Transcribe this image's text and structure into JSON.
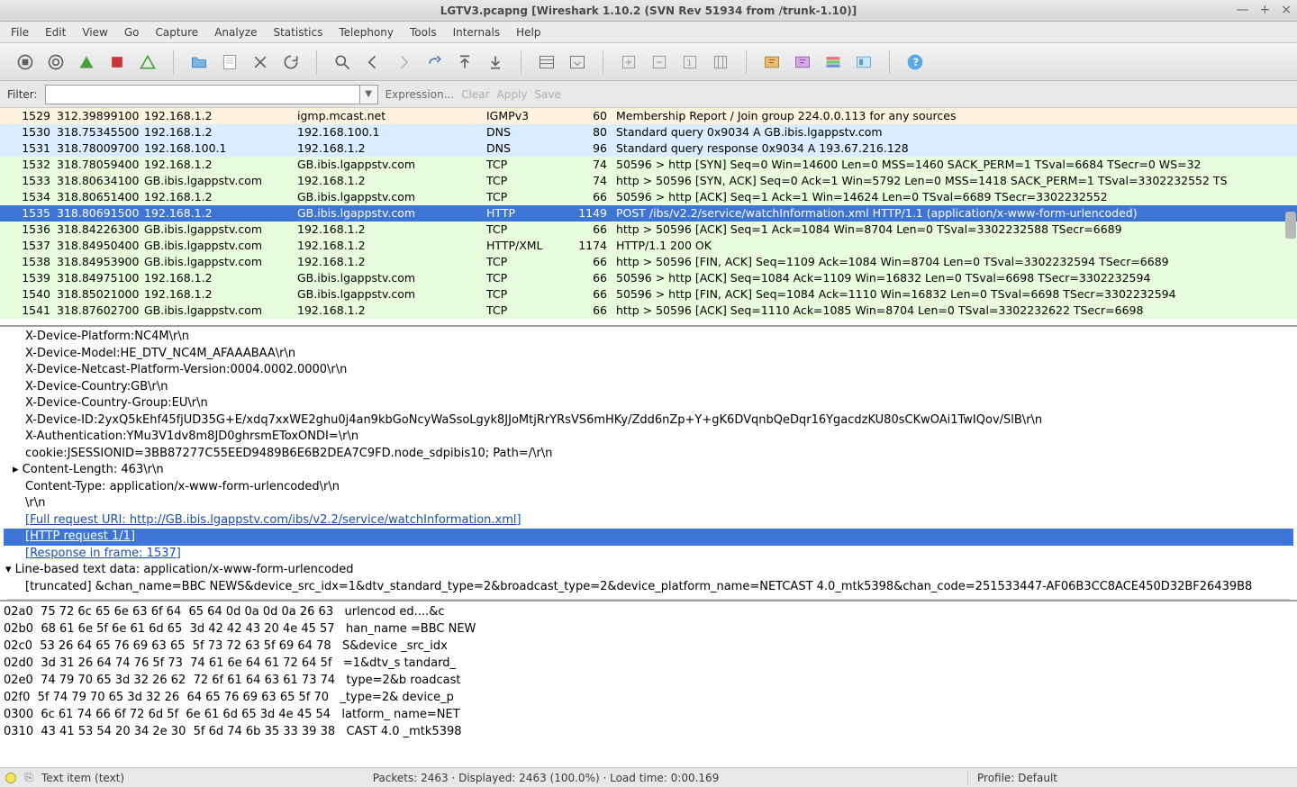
{
  "window": {
    "title": "LGTV3.pcapng   [Wireshark 1.10.2  (SVN Rev 51934 from /trunk-1.10)]",
    "minimize": "—",
    "maximize": "+",
    "close": "×"
  },
  "menu": [
    "File",
    "Edit",
    "View",
    "Go",
    "Capture",
    "Analyze",
    "Statistics",
    "Telephony",
    "Tools",
    "Internals",
    "Help"
  ],
  "filter": {
    "label": "Filter:",
    "value": "",
    "expression": "Expression...",
    "clear": "Clear",
    "apply": "Apply",
    "save": "Save"
  },
  "packets": [
    {
      "cls": "row-igmp",
      "no": "1529",
      "time": "312.39899100",
      "src": "192.168.1.2",
      "dst": "igmp.mcast.net",
      "proto": "IGMPv3",
      "len": "60",
      "info": "Membership Report / Join group 224.0.0.113 for any sources"
    },
    {
      "cls": "row-dns",
      "no": "1530",
      "time": "318.75345500",
      "src": "192.168.1.2",
      "dst": "192.168.100.1",
      "proto": "DNS",
      "len": "80",
      "info": "Standard query 0x9034  A GB.ibis.lgappstv.com"
    },
    {
      "cls": "row-dns",
      "no": "1531",
      "time": "318.78009700",
      "src": "192.168.100.1",
      "dst": "192.168.1.2",
      "proto": "DNS",
      "len": "96",
      "info": "Standard query response 0x9034  A 193.67.216.128"
    },
    {
      "cls": "row-tcp",
      "no": "1532",
      "time": "318.78059400",
      "src": "192.168.1.2",
      "dst": "GB.ibis.lgappstv.com",
      "proto": "TCP",
      "len": "74",
      "info": "50596 > http [SYN] Seq=0 Win=14600 Len=0 MSS=1460 SACK_PERM=1 TSval=6684 TSecr=0 WS=32"
    },
    {
      "cls": "row-tcp",
      "no": "1533",
      "time": "318.80634100",
      "src": "GB.ibis.lgappstv.com",
      "dst": "192.168.1.2",
      "proto": "TCP",
      "len": "74",
      "info": "http > 50596 [SYN, ACK] Seq=0 Ack=1 Win=5792 Len=0 MSS=1418 SACK_PERM=1 TSval=3302232552 TS"
    },
    {
      "cls": "row-tcp",
      "no": "1534",
      "time": "318.80651400",
      "src": "192.168.1.2",
      "dst": "GB.ibis.lgappstv.com",
      "proto": "TCP",
      "len": "66",
      "info": "50596 > http [ACK] Seq=1 Ack=1 Win=14624 Len=0 TSval=6689 TSecr=3302232552"
    },
    {
      "cls": "row-selected",
      "no": "1535",
      "time": "318.80691500",
      "src": "192.168.1.2",
      "dst": "GB.ibis.lgappstv.com",
      "proto": "HTTP",
      "len": "1149",
      "info": "POST /ibs/v2.2/service/watchInformation.xml HTTP/1.1   (application/x-www-form-urlencoded)"
    },
    {
      "cls": "row-tcp",
      "no": "1536",
      "time": "318.84226300",
      "src": "GB.ibis.lgappstv.com",
      "dst": "192.168.1.2",
      "proto": "TCP",
      "len": "66",
      "info": "http > 50596 [ACK] Seq=1 Ack=1084 Win=8704 Len=0 TSval=3302232588 TSecr=6689"
    },
    {
      "cls": "row-http",
      "no": "1537",
      "time": "318.84950400",
      "src": "GB.ibis.lgappstv.com",
      "dst": "192.168.1.2",
      "proto": "HTTP/XML",
      "len": "1174",
      "info": "HTTP/1.1 200 OK"
    },
    {
      "cls": "row-tcp",
      "no": "1538",
      "time": "318.84953900",
      "src": "GB.ibis.lgappstv.com",
      "dst": "192.168.1.2",
      "proto": "TCP",
      "len": "66",
      "info": "http > 50596 [FIN, ACK] Seq=1109 Ack=1084 Win=8704 Len=0 TSval=3302232594 TSecr=6689"
    },
    {
      "cls": "row-tcp",
      "no": "1539",
      "time": "318.84975100",
      "src": "192.168.1.2",
      "dst": "GB.ibis.lgappstv.com",
      "proto": "TCP",
      "len": "66",
      "info": "50596 > http [ACK] Seq=1084 Ack=1109 Win=16832 Len=0 TSval=6698 TSecr=3302232594"
    },
    {
      "cls": "row-tcp",
      "no": "1540",
      "time": "318.85021000",
      "src": "192.168.1.2",
      "dst": "GB.ibis.lgappstv.com",
      "proto": "TCP",
      "len": "66",
      "info": "50596 > http [FIN, ACK] Seq=1084 Ack=1110 Win=16832 Len=0 TSval=6698 TSecr=3302232594"
    },
    {
      "cls": "row-tcp",
      "no": "1541",
      "time": "318.87602700",
      "src": "GB.ibis.lgappstv.com",
      "dst": "192.168.1.2",
      "proto": "TCP",
      "len": "66",
      "info": "http > 50596 [ACK] Seq=1110 Ack=1085 Win=8704 Len=0 TSval=3302232622 TSecr=6698"
    }
  ],
  "detail": [
    {
      "cls": "line",
      "text": "X-Device-Platform:NC4M\\r\\n"
    },
    {
      "cls": "line",
      "text": "X-Device-Model:HE_DTV_NC4M_AFAAABAA\\r\\n"
    },
    {
      "cls": "line",
      "text": "X-Device-Netcast-Platform-Version:0004.0002.0000\\r\\n"
    },
    {
      "cls": "line",
      "text": "X-Device-Country:GB\\r\\n"
    },
    {
      "cls": "line",
      "text": "X-Device-Country-Group:EU\\r\\n"
    },
    {
      "cls": "line",
      "text": "X-Device-ID:2yxQ5kEhf45fjUD35G+E/xdq7xxWE2ghu0j4an9kbGoNcyWaSsoLgyk8JJoMtjRrYRsVS6mHKy/Zdd6nZp+Y+gK6DVqnbQeDqr16YgacdzKU80sCKwOAi1TwIQov/SlB\\r\\n"
    },
    {
      "cls": "line",
      "text": "X-Authentication:YMu3V1dv8m8JD0ghrsmEToxONDI=\\r\\n"
    },
    {
      "cls": "line",
      "text": "cookie:JSESSIONID=3BB87277C55EED9489B6E6B2DEA7C9FD.node_sdpibis10; Path=/\\r\\n"
    },
    {
      "cls": "line tri",
      "text": "▸ Content-Length: 463\\r\\n"
    },
    {
      "cls": "line",
      "text": "Content-Type: application/x-www-form-urlencoded\\r\\n"
    },
    {
      "cls": "line",
      "text": "\\r\\n"
    },
    {
      "cls": "line link",
      "text": "[Full request URI: http://GB.ibis.lgappstv.com/ibs/v2.2/service/watchInformation.xml]"
    },
    {
      "cls": "line link sel",
      "text": "[HTTP request 1/1]"
    },
    {
      "cls": "line link",
      "text": "[Response in frame: 1537]"
    },
    {
      "cls": "line sect",
      "text": "▾ Line-based text data: application/x-www-form-urlencoded"
    },
    {
      "cls": "line",
      "text": "[truncated] &chan_name=BBC NEWS&device_src_idx=1&dtv_standard_type=2&broadcast_type=2&device_platform_name=NETCAST 4.0_mtk5398&chan_code=251533447-AF06B3CC8ACE450D32BF26439B8"
    }
  ],
  "hex": [
    "02a0  75 72 6c 65 6e 63 6f 64  65 64 0d 0a 0d 0a 26 63   urlencod ed....&c",
    "02b0  68 61 6e 5f 6e 61 6d 65  3d 42 42 43 20 4e 45 57   han_name =BBC NEW",
    "02c0  53 26 64 65 76 69 63 65  5f 73 72 63 5f 69 64 78   S&device _src_idx",
    "02d0  3d 31 26 64 74 76 5f 73  74 61 6e 64 61 72 64 5f   =1&dtv_s tandard_",
    "02e0  74 79 70 65 3d 32 26 62  72 6f 61 64 63 61 73 74   type=2&b roadcast",
    "02f0  5f 74 79 70 65 3d 32 26  64 65 76 69 63 65 5f 70   _type=2& device_p",
    "0300  6c 61 74 66 6f 72 6d 5f  6e 61 6d 65 3d 4e 45 54   latform_ name=NET",
    "0310  43 41 53 54 20 34 2e 30  5f 6d 74 6b 35 33 39 38   CAST 4.0 _mtk5398"
  ],
  "status": {
    "left": "Text item (text)",
    "middle": "Packets: 2463 · Displayed: 2463 (100.0%) · Load time: 0:00.169",
    "right": "Profile: Default"
  }
}
